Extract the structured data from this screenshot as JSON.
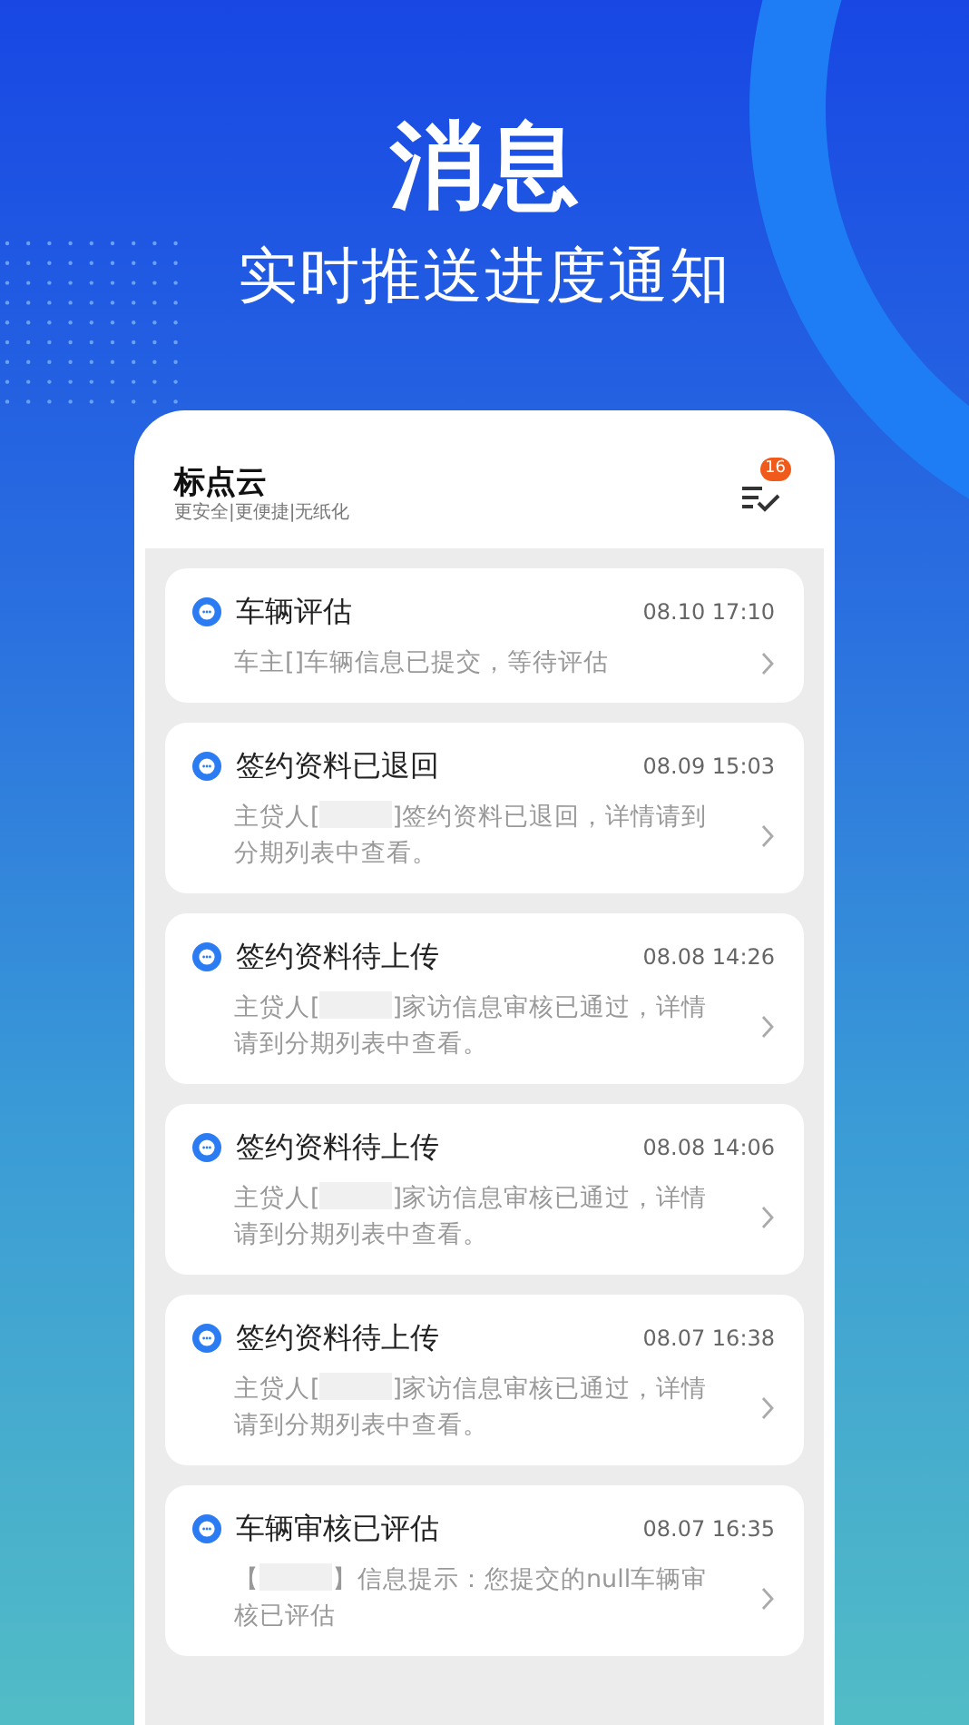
{
  "hero": {
    "title": "消息",
    "subtitle": "实时推送进度通知"
  },
  "app": {
    "name": "标点云",
    "tagline": "更安全|更便捷|无纸化",
    "badge": "16"
  },
  "messages": [
    {
      "title": "车辆评估",
      "time": "08.10 17:10",
      "body": [
        {
          "kind": "text",
          "text": "车主[]车辆信息已提交，等待评估"
        }
      ]
    },
    {
      "title": "签约资料已退回",
      "time": "08.09 15:03",
      "body": [
        {
          "kind": "text",
          "text": "主贷人["
        },
        {
          "kind": "redacted"
        },
        {
          "kind": "text",
          "text": "]签约资料已退回，详情请到分期列表中查看。"
        }
      ]
    },
    {
      "title": "签约资料待上传",
      "time": "08.08 14:26",
      "body": [
        {
          "kind": "text",
          "text": "主贷人["
        },
        {
          "kind": "redacted"
        },
        {
          "kind": "text",
          "text": "]家访信息审核已通过，详情请到分期列表中查看。"
        }
      ]
    },
    {
      "title": "签约资料待上传",
      "time": "08.08 14:06",
      "body": [
        {
          "kind": "text",
          "text": "主贷人["
        },
        {
          "kind": "redacted"
        },
        {
          "kind": "text",
          "text": "]家访信息审核已通过，详情请到分期列表中查看。"
        }
      ]
    },
    {
      "title": "签约资料待上传",
      "time": "08.07 16:38",
      "body": [
        {
          "kind": "text",
          "text": "主贷人["
        },
        {
          "kind": "redacted"
        },
        {
          "kind": "text",
          "text": "]家访信息审核已通过，详情请到分期列表中查看。"
        }
      ]
    },
    {
      "title": "车辆审核已评估",
      "time": "08.07 16:35",
      "body": [
        {
          "kind": "text",
          "text": "【"
        },
        {
          "kind": "redacted"
        },
        {
          "kind": "text",
          "text": "】信息提示：您提交的null车辆审核已评估"
        }
      ]
    }
  ]
}
